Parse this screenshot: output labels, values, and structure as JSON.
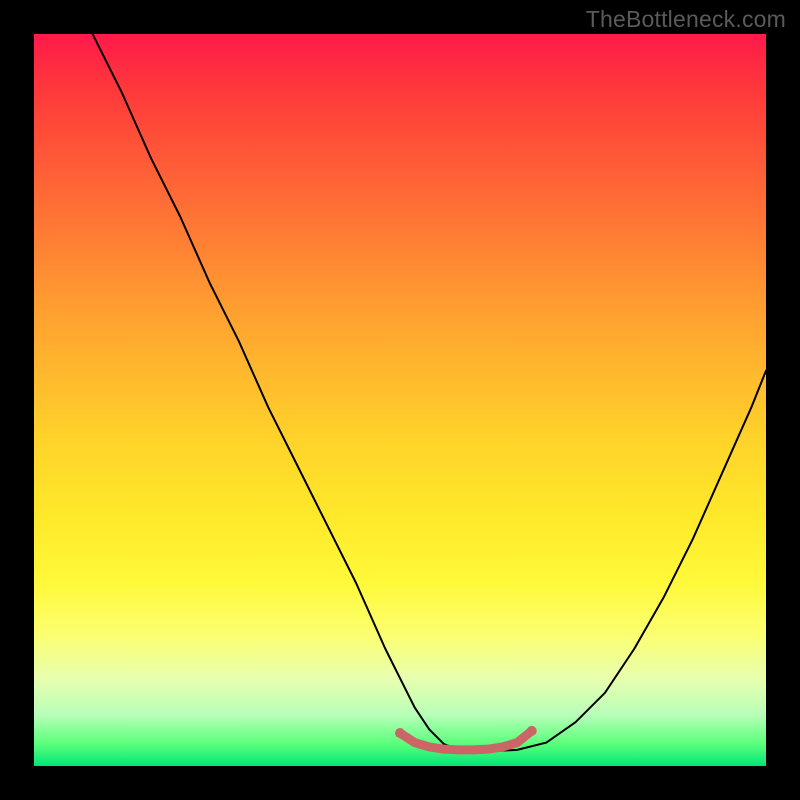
{
  "watermark": "TheBottleneck.com",
  "chart_data": {
    "type": "line",
    "title": "",
    "xlabel": "",
    "ylabel": "",
    "xlim": [
      0,
      100
    ],
    "ylim": [
      0,
      100
    ],
    "series": [
      {
        "name": "curve",
        "color": "#000000",
        "x": [
          8,
          12,
          16,
          20,
          24,
          28,
          32,
          36,
          40,
          44,
          48,
          50,
          52,
          54,
          56,
          58,
          60,
          62,
          66,
          70,
          74,
          78,
          82,
          86,
          90,
          94,
          98,
          100
        ],
        "y": [
          100,
          92,
          83,
          75,
          66,
          58,
          49,
          41,
          33,
          25,
          16,
          12,
          8,
          5,
          3,
          2.2,
          2,
          2,
          2.2,
          3.2,
          6,
          10,
          16,
          23,
          31,
          40,
          49,
          54
        ]
      },
      {
        "name": "flat-segment",
        "color": "#cc6666",
        "x": [
          50,
          52,
          54,
          56,
          58,
          60,
          62,
          64,
          66,
          68
        ],
        "y": [
          4.5,
          3.2,
          2.6,
          2.3,
          2.2,
          2.2,
          2.3,
          2.6,
          3.2,
          4.8
        ]
      }
    ],
    "markers": [
      {
        "name": "flat-left-end",
        "x": 50,
        "y": 4.5,
        "color": "#cc6666",
        "r": 5
      },
      {
        "name": "flat-right-end",
        "x": 68,
        "y": 4.8,
        "color": "#cc6666",
        "r": 5
      }
    ]
  }
}
